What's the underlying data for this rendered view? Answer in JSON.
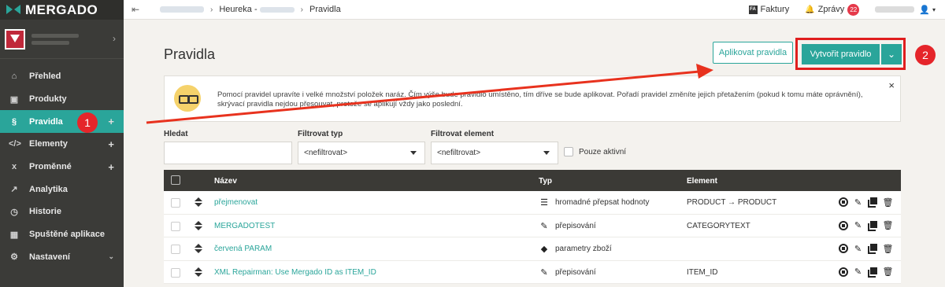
{
  "brand": {
    "name": "MERGADO"
  },
  "sidebar": {
    "items": [
      {
        "label": "Přehled",
        "icon": "home-icon",
        "glyph": "⌂"
      },
      {
        "label": "Produkty",
        "icon": "box-icon",
        "glyph": "▣"
      },
      {
        "label": "Pravidla",
        "icon": "section-icon",
        "glyph": "§",
        "active": true,
        "plus": "+",
        "annotation": "1"
      },
      {
        "label": "Elementy",
        "icon": "code-icon",
        "glyph": "</>",
        "plus": "+"
      },
      {
        "label": "Proměnné",
        "icon": "variable-icon",
        "glyph": "x",
        "plus": "+"
      },
      {
        "label": "Analytika",
        "icon": "chart-icon",
        "glyph": "↗"
      },
      {
        "label": "Historie",
        "icon": "clock-icon",
        "glyph": "◷"
      },
      {
        "label": "Spuštěné aplikace",
        "icon": "apps-icon",
        "glyph": "▦"
      },
      {
        "label": "Nastavení",
        "icon": "gear-icon",
        "glyph": "⚙",
        "chevron": "⌄"
      }
    ]
  },
  "topbar": {
    "breadcrumbs": [
      "Heureka -",
      "Pravidla"
    ],
    "invoices_label": "Faktury",
    "invoices_icon_text": "FA",
    "messages_label": "Zprávy",
    "messages_count": "22"
  },
  "page": {
    "title": "Pravidla",
    "apply_button": "Aplikovat pravidla",
    "create_button": "Vytvořit pravidlo",
    "annotation_2": "2",
    "info_text": "Pomocí pravidel upravíte i velké množství položek naráz. Čím výše bude pravidlo umístěno, tím dříve se bude aplikovat. Pořadí pravidel změníte jejich přetažením (pokud k tomu máte oprávnění), skrývací pravidla nejdou přesouvat, protože se aplikují vždy jako poslední.",
    "info_close": "×"
  },
  "filters": {
    "search_label": "Hledat",
    "search_value": "",
    "type_label": "Filtrovat typ",
    "type_value": "<nefiltrovat>",
    "element_label": "Filtrovat element",
    "element_value": "<nefiltrovat>",
    "active_only_label": "Pouze aktivní"
  },
  "table": {
    "headers": {
      "name": "Název",
      "type": "Typ",
      "element": "Element"
    },
    "rows": [
      {
        "name": "přejmenovat",
        "type": "hromadné přepsat hodnoty",
        "type_icon": "list-icon",
        "type_glyph": "☰",
        "element": "PRODUCT → PRODUCT"
      },
      {
        "name": "MERGADOTEST",
        "type": "přepisování",
        "type_icon": "pencil-icon",
        "type_glyph": "✎",
        "element": "CATEGORYTEXT"
      },
      {
        "name": "červená PARAM",
        "type": "parametry zboží",
        "type_icon": "tag-icon",
        "type_glyph": "◆",
        "element": ""
      },
      {
        "name": "XML Repairman: Use Mergado ID as ITEM_ID",
        "type": "přepisování",
        "type_icon": "pencil-icon",
        "type_glyph": "✎",
        "element": "ITEM_ID"
      }
    ]
  },
  "colors": {
    "accent": "#2aa59a",
    "annotation": "#e01e1e",
    "sidebar": "#3b3b38"
  }
}
